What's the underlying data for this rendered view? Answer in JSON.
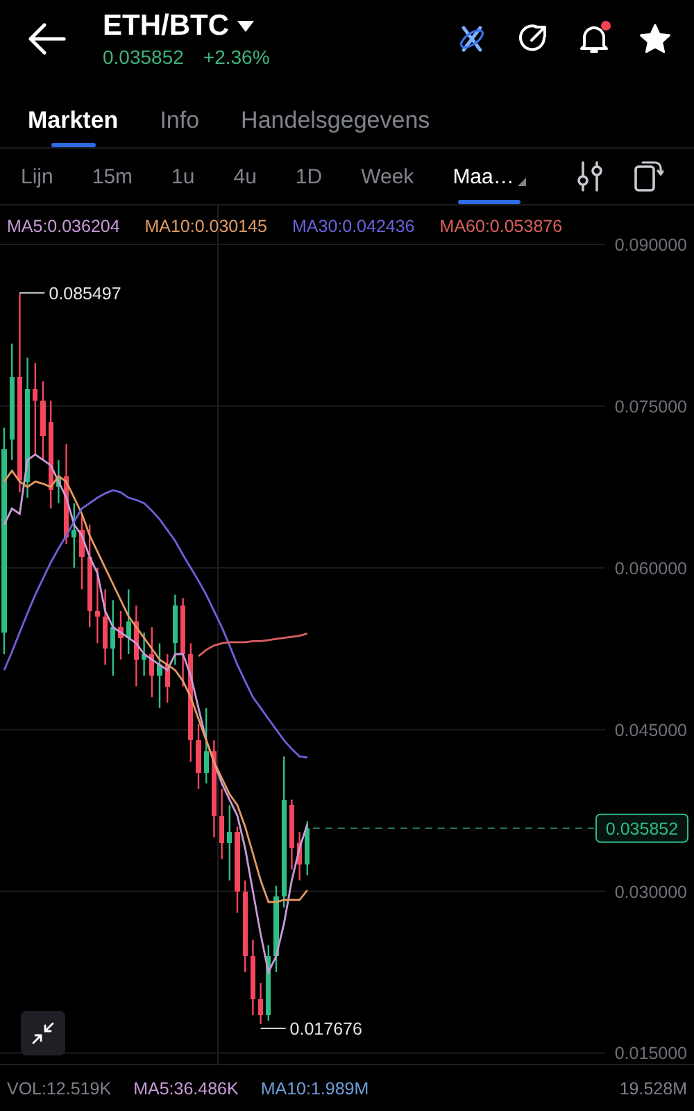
{
  "header": {
    "pair": "ETH/BTC",
    "price": "0.035852",
    "change": "+2.36%",
    "has_notification": true,
    "favorite": true
  },
  "tabs": [
    {
      "label": "Markten",
      "selected": true
    },
    {
      "label": "Info",
      "selected": false
    },
    {
      "label": "Handelsgegevens",
      "selected": false
    }
  ],
  "intervals": [
    {
      "label": "Lijn",
      "selected": false,
      "dropdown": false
    },
    {
      "label": "15m",
      "selected": false,
      "dropdown": false
    },
    {
      "label": "1u",
      "selected": false,
      "dropdown": false
    },
    {
      "label": "4u",
      "selected": false,
      "dropdown": false
    },
    {
      "label": "1D",
      "selected": false,
      "dropdown": false
    },
    {
      "label": "Week",
      "selected": false,
      "dropdown": false
    },
    {
      "label": "Maa…",
      "selected": true,
      "dropdown": true
    }
  ],
  "chart": {
    "high_label": "0.085497",
    "low_label": "0.017676",
    "price_tag": "0.035852",
    "chart_data": {
      "type": "candlestick",
      "grid": true,
      "ylim": [
        0.014,
        0.0936
      ],
      "categories": [
        null,
        null,
        null,
        null,
        null,
        null,
        null,
        null,
        null,
        null,
        null,
        null,
        null,
        null,
        null,
        null,
        null,
        null,
        null,
        null,
        null,
        null,
        null,
        null,
        null,
        null,
        null,
        null,
        null,
        null,
        null,
        null,
        null,
        null,
        null,
        null,
        null,
        null,
        null,
        null
      ],
      "yticks": [
        {
          "value": 0.09,
          "label": "0.090000"
        },
        {
          "value": 0.075,
          "label": "0.075000"
        },
        {
          "value": 0.06,
          "label": "0.060000"
        },
        {
          "value": 0.045,
          "label": "0.045000"
        },
        {
          "value": 0.03,
          "label": "0.030000"
        },
        {
          "value": 0.015,
          "label": "0.015000"
        }
      ],
      "ohlc": [
        [
          0.054,
          0.073,
          0.052,
          0.071
        ],
        [
          0.0719,
          0.0808,
          0.07,
          0.0777
        ],
        [
          0.0777,
          0.0855,
          0.067,
          0.0681
        ],
        [
          0.068,
          0.0795,
          0.0665,
          0.0766
        ],
        [
          0.0766,
          0.079,
          0.0705,
          0.0755
        ],
        [
          0.0755,
          0.0773,
          0.07,
          0.0722
        ],
        [
          0.0735,
          0.0755,
          0.0655,
          0.0672
        ],
        [
          0.0675,
          0.07,
          0.066,
          0.0685
        ],
        [
          0.0685,
          0.0715,
          0.0622,
          0.0628
        ],
        [
          0.0628,
          0.066,
          0.06,
          0.0635
        ],
        [
          0.0635,
          0.065,
          0.058,
          0.061
        ],
        [
          0.061,
          0.064,
          0.0545,
          0.056
        ],
        [
          0.056,
          0.06,
          0.053,
          0.0555
        ],
        [
          0.0555,
          0.058,
          0.051,
          0.0525
        ],
        [
          0.0525,
          0.057,
          0.05,
          0.0545
        ],
        [
          0.0545,
          0.056,
          0.0515,
          0.0535
        ],
        [
          0.0535,
          0.058,
          0.052,
          0.055
        ],
        [
          0.055,
          0.0565,
          0.049,
          0.0515
        ],
        [
          0.0515,
          0.054,
          0.05,
          0.052
        ],
        [
          0.052,
          0.0545,
          0.048,
          0.05
        ],
        [
          0.05,
          0.053,
          0.047,
          0.051
        ],
        [
          0.051,
          0.052,
          0.0475,
          0.049
        ],
        [
          0.053,
          0.0575,
          0.051,
          0.0565
        ],
        [
          0.0565,
          0.0572,
          0.049,
          0.052
        ],
        [
          0.052,
          0.053,
          0.042,
          0.044
        ],
        [
          0.044,
          0.0455,
          0.0395,
          0.041
        ],
        [
          0.041,
          0.047,
          0.04,
          0.043
        ],
        [
          0.043,
          0.044,
          0.035,
          0.037
        ],
        [
          0.037,
          0.0395,
          0.033,
          0.0345
        ],
        [
          0.0345,
          0.038,
          0.031,
          0.0355
        ],
        [
          0.0355,
          0.036,
          0.028,
          0.03
        ],
        [
          0.03,
          0.031,
          0.0225,
          0.024
        ],
        [
          0.024,
          0.0255,
          0.0185,
          0.02
        ],
        [
          0.02,
          0.0215,
          0.017676,
          0.0185
        ],
        [
          0.0185,
          0.025,
          0.018,
          0.024
        ],
        [
          0.024,
          0.0305,
          0.0225,
          0.0295
        ],
        [
          0.0295,
          0.0425,
          0.0285,
          0.0385
        ],
        [
          0.038,
          0.0385,
          0.032,
          0.034
        ],
        [
          0.0345,
          0.0355,
          0.031,
          0.0325
        ],
        [
          0.0325,
          0.0365,
          0.0315,
          0.035852
        ]
      ],
      "series": [
        {
          "name": "MA5:0.036204",
          "type": "line",
          "color": "#c89bd8",
          "values": [
            0.064,
            0.0655,
            0.065,
            0.07,
            0.0705,
            0.07,
            0.0695,
            0.068,
            0.0665,
            0.064,
            0.063,
            0.061,
            0.0595,
            0.056,
            0.0545,
            0.054,
            0.0535,
            0.053,
            0.052,
            0.0515,
            0.051,
            0.0505,
            0.052,
            0.052,
            0.05,
            0.047,
            0.044,
            0.042,
            0.04,
            0.0385,
            0.037,
            0.034,
            0.03,
            0.026,
            0.0225,
            0.024,
            0.027,
            0.031,
            0.034,
            0.0362
          ]
        },
        {
          "name": "MA10:0.030145",
          "type": "line",
          "color": "#e39a63",
          "values": [
            0.068,
            0.069,
            0.068,
            0.0675,
            0.068,
            0.0678,
            0.0675,
            0.0685,
            0.068,
            0.0665,
            0.065,
            0.063,
            0.0615,
            0.06,
            0.0585,
            0.057,
            0.0555,
            0.0545,
            0.0535,
            0.0525,
            0.0515,
            0.051,
            0.0505,
            0.0495,
            0.048,
            0.046,
            0.044,
            0.042,
            0.0405,
            0.039,
            0.038,
            0.036,
            0.0335,
            0.031,
            0.029,
            0.029,
            0.0292,
            0.0292,
            0.0292,
            0.0301
          ]
        },
        {
          "name": "MA30:0.042436",
          "type": "line",
          "color": "#6b62dc",
          "values": [
            0.0505,
            0.0522,
            0.054,
            0.0558,
            0.0575,
            0.059,
            0.0605,
            0.0618,
            0.063,
            0.0643,
            0.0655,
            0.066,
            0.0665,
            0.0669,
            0.0672,
            0.067,
            0.0665,
            0.0663,
            0.066,
            0.0653,
            0.0645,
            0.0635,
            0.0625,
            0.0612,
            0.06,
            0.0588,
            0.0575,
            0.056,
            0.0545,
            0.0528,
            0.051,
            0.0495,
            0.048,
            0.047,
            0.046,
            0.045,
            0.044,
            0.0432,
            0.0425,
            0.0424
          ]
        },
        {
          "name": "MA60:0.053876",
          "type": "line",
          "color": "#d9605e",
          "values": [
            null,
            null,
            null,
            null,
            null,
            null,
            null,
            null,
            null,
            null,
            null,
            null,
            null,
            null,
            null,
            null,
            null,
            null,
            null,
            null,
            null,
            null,
            null,
            null,
            null,
            0.0518,
            0.0524,
            0.0528,
            0.053,
            0.0531,
            0.0531,
            0.0531,
            0.0532,
            0.0532,
            0.0533,
            0.0534,
            0.0535,
            0.0536,
            0.0537,
            0.0539
          ]
        }
      ]
    }
  },
  "volume": {
    "items": [
      {
        "label": "VOL:12.519K",
        "color": "#7d808a"
      },
      {
        "label": "MA5:36.486K",
        "color": "#c89bd8"
      },
      {
        "label": "MA10:1.989M",
        "color": "#6f9fd8"
      }
    ],
    "axis_label": "19.528M"
  }
}
